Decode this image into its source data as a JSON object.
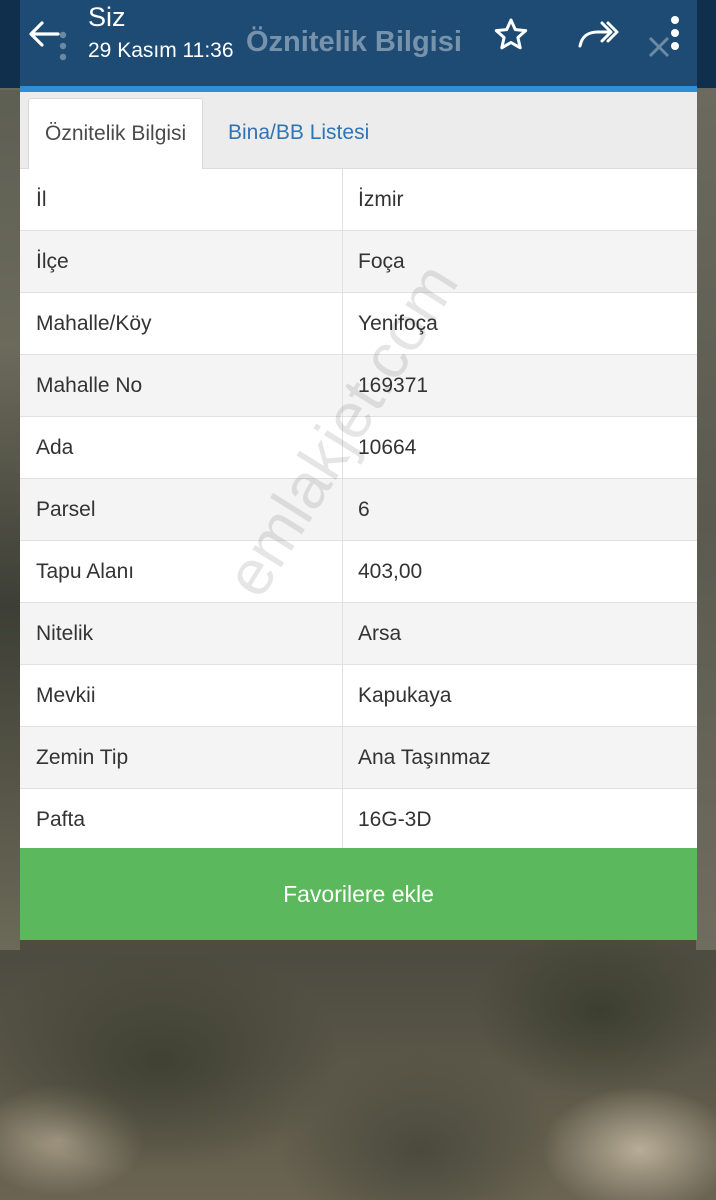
{
  "appbar": {
    "title": "Siz",
    "subtitle": "29 Kasım 11:36",
    "ghost_title": "Öznitelik Bilgisi",
    "icons": [
      "back-arrow-icon",
      "star-icon",
      "share-icon",
      "more-vert-icon"
    ]
  },
  "tabs": [
    {
      "label": "Öznitelik Bilgisi",
      "active": true
    },
    {
      "label": "Bina/BB Listesi",
      "active": false
    }
  ],
  "attributes": [
    {
      "key": "İl",
      "value": "İzmir"
    },
    {
      "key": "İlçe",
      "value": "Foça"
    },
    {
      "key": "Mahalle/Köy",
      "value": "Yenifoça"
    },
    {
      "key": "Mahalle No",
      "value": "169371"
    },
    {
      "key": "Ada",
      "value": "10664"
    },
    {
      "key": "Parsel",
      "value": "6"
    },
    {
      "key": "Tapu Alanı",
      "value": "403,00"
    },
    {
      "key": "Nitelik",
      "value": "Arsa"
    },
    {
      "key": "Mevkii",
      "value": "Kapukaya"
    },
    {
      "key": "Zemin Tip",
      "value": "Ana Taşınmaz"
    },
    {
      "key": "Pafta",
      "value": "16G-3D"
    }
  ],
  "favorite_button": {
    "label": "Favorilere ekle",
    "color": "#5cb85c"
  },
  "watermark": "emlakjet.com",
  "colors": {
    "appbar": "#1d4b73",
    "accent": "#2e8ed6",
    "tab_link": "#2f74b5"
  }
}
